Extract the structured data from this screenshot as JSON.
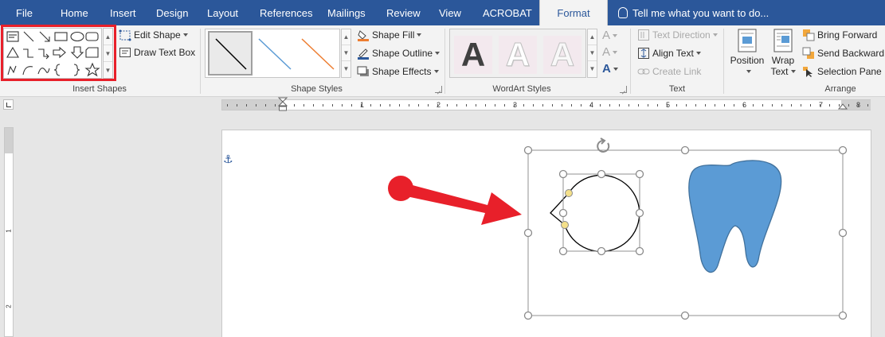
{
  "tabs": [
    {
      "label": "File"
    },
    {
      "label": "Home"
    },
    {
      "label": "Insert"
    },
    {
      "label": "Design"
    },
    {
      "label": "Layout"
    },
    {
      "label": "References"
    },
    {
      "label": "Mailings"
    },
    {
      "label": "Review"
    },
    {
      "label": "View"
    },
    {
      "label": "ACROBAT"
    },
    {
      "label": "Format"
    }
  ],
  "tell_me": "Tell me what you want to do...",
  "ribbon": {
    "insert_shapes": {
      "label": "Insert Shapes",
      "edit_shape": "Edit Shape",
      "draw_text_box": "Draw Text Box"
    },
    "shape_styles": {
      "label": "Shape Styles",
      "shape_fill": "Shape Fill",
      "shape_outline": "Shape Outline",
      "shape_effects": "Shape Effects"
    },
    "wordart_styles": {
      "label": "WordArt Styles",
      "letter": "A"
    },
    "text": {
      "label": "Text",
      "text_direction": "Text Direction",
      "align_text": "Align Text",
      "create_link": "Create Link"
    },
    "arrange": {
      "label": "Arrange",
      "position": "Position",
      "wrap_text_1": "Wrap",
      "wrap_text_2": "Text",
      "bring_forward": "Bring Forward",
      "send_backward": "Send Backward",
      "selection_pane": "Selection Pane"
    }
  },
  "ruler": {
    "numbers": [
      "1",
      "2",
      "3",
      "4",
      "5",
      "6",
      "7",
      "8"
    ],
    "vertical_numbers": [
      "1",
      "2"
    ]
  },
  "colors": {
    "title_bar": "#2b579a",
    "callout_red": "#e8202a",
    "tooth_fill": "#5b9bd5",
    "handle_yellow": "#f4e08a"
  }
}
